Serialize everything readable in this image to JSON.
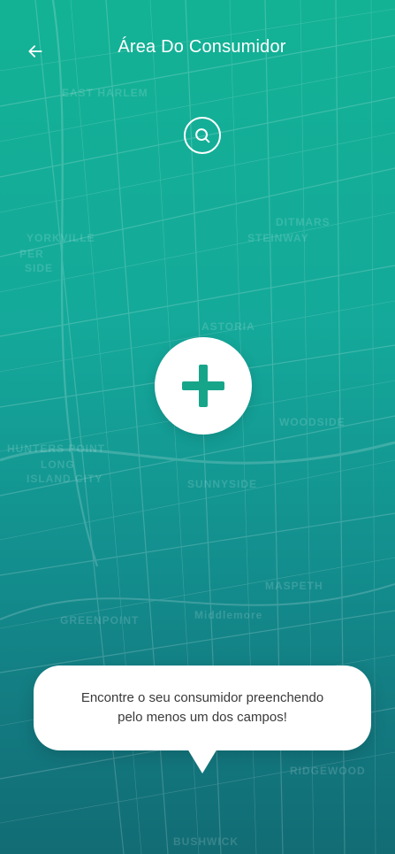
{
  "header": {
    "title": "Área Do Consumidor",
    "back_icon": "arrow-left-icon",
    "search_icon": "search-icon"
  },
  "main": {
    "add_icon": "plus-icon"
  },
  "hint": {
    "line1": "Encontre o seu consumidor preenchendo",
    "line2": "pelo menos um dos campos!"
  },
  "map_labels": [
    "EAST HARLEM",
    "YORKVILLE",
    "PER",
    "SIDE",
    "DITMARS",
    "STEINWAY",
    "ASTORIA",
    "WOODSIDE",
    "HUNTERS POINT",
    "LONG",
    "ISLAND CITY",
    "SUNNYSIDE",
    "MASPETH",
    "GREENPOINT",
    "Middlemore",
    "RIDGEWOOD",
    "BUSHWICK"
  ],
  "colors": {
    "gradient_top": "#13b295",
    "gradient_bottom": "#126c74",
    "accent": "#17a58a",
    "bubble_text": "#3a3a3a"
  }
}
